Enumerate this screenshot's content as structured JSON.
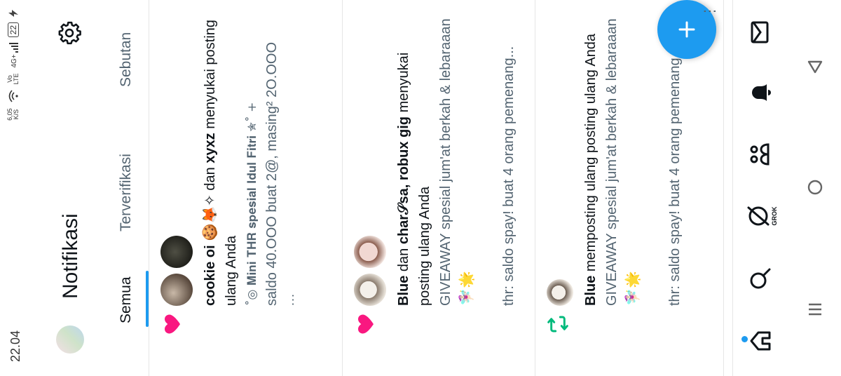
{
  "status_bar": {
    "time": "22.04",
    "speed_value": "6,05",
    "speed_unit": "K/S",
    "volte": "Vo\nLTE",
    "network": "4G+",
    "battery": "22"
  },
  "header": {
    "title": "Notifikasi"
  },
  "tabs": [
    {
      "label": "Semua",
      "active": true
    },
    {
      "label": "Terverifikasi",
      "active": false
    },
    {
      "label": "Sebutan",
      "active": false
    }
  ],
  "notifications": [
    {
      "icon": "heart-icon",
      "actor_line": {
        "user1": "cookie oi",
        "user1_emoji": "🍪🦊✧",
        "connector": " dan ",
        "user2": "xyxz",
        "action": " menyukai posting ulang Anda"
      },
      "preview_title": "˚◎ 𝐌𝐢𝐧𝐢 𝐓𝐇𝐑 𝐬𝐩𝐞𝐬𝐢𝐚𝐥 𝐈𝐝𝐮𝐥 𝐅𝐢𝐭𝐫𝐢 ✮˚ +",
      "preview_body": "saldo 40.OOO buat 2@, masing² 2O.OOO",
      "more": "..."
    },
    {
      "icon": "heart-icon",
      "actor_line": {
        "user1": "Blue",
        "connector": " dan ",
        "user2": "char𝒮sa, robux gig",
        "action": " menyukai posting ulang Anda"
      },
      "preview_body": "GIVEAWAY spesial jum'at berkah & lebaraaan 🧚🏻‍♀️🌟",
      "preview_more": "thr: saldo spay! buat 4 orang pemenang..."
    },
    {
      "icon": "retweet-icon",
      "actor_line": {
        "user1": "Blue",
        "action": " memposting ulang posting ulang Anda"
      },
      "preview_body": "GIVEAWAY spesial jum'at berkah & lebaraaan 🧚🏻‍♀️🌟",
      "preview_more": "thr: saldo spay! buat 4 orang pemenang..."
    }
  ],
  "bottom_nav": [
    {
      "name": "home-icon"
    },
    {
      "name": "search-icon"
    },
    {
      "name": "grok-icon",
      "label": "GROK"
    },
    {
      "name": "communities-icon"
    },
    {
      "name": "notifications-icon"
    },
    {
      "name": "messages-icon"
    }
  ],
  "colors": {
    "accent": "#1d9bf0",
    "like": "#f91880",
    "retweet": "#00ba7c",
    "muted": "#536471"
  }
}
